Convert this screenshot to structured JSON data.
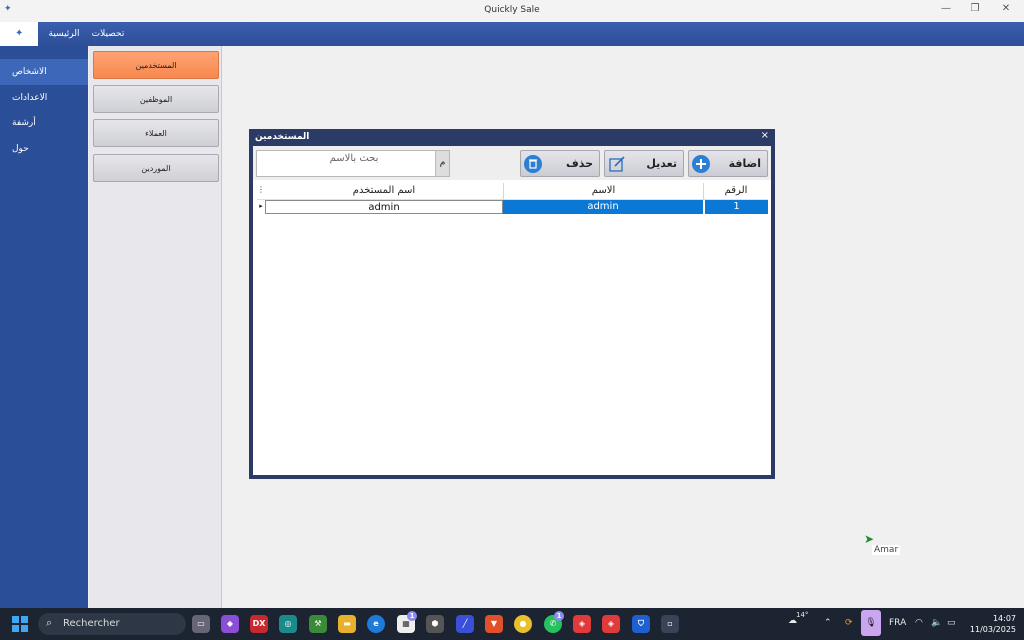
{
  "window": {
    "title": "Quickly Sale",
    "minimize_glyph": "—",
    "restore_glyph": "❐",
    "close_glyph": "✕"
  },
  "ribbon": {
    "tabs": [
      "الرئيسية",
      "تحصيلات"
    ]
  },
  "leftnav": {
    "items": [
      {
        "label": "الاشخاص",
        "active": true
      },
      {
        "label": "الاعدادات",
        "active": false
      },
      {
        "label": "أرشفة",
        "active": false
      },
      {
        "label": "حول",
        "active": false
      }
    ]
  },
  "subpanel": {
    "buttons": [
      {
        "label": "المستخدمين",
        "active": true
      },
      {
        "label": "الموظفين",
        "active": false
      },
      {
        "label": "العملاء",
        "active": false
      },
      {
        "label": "الموردين",
        "active": false
      }
    ]
  },
  "dialog": {
    "title": "المستخدمين",
    "close_glyph": "×",
    "search": {
      "placeholder": "بحث بالاسم",
      "button": "م"
    },
    "toolbar": {
      "add_label": "اضافة",
      "edit_label": "تعديل",
      "delete_label": "حذف"
    },
    "grid": {
      "columns": [
        "الرقم",
        "الاسم",
        "اسم المستخدم"
      ],
      "rows": [
        {
          "id": "1",
          "name": "admin",
          "username": "admin"
        }
      ]
    }
  },
  "cursor_label": "Amar",
  "taskbar": {
    "search_placeholder": "Rechercher",
    "weather": "14°",
    "language": "FRA",
    "time": "14:07",
    "date": "11/03/2025",
    "badges": {
      "store": "1",
      "whatsapp": "1"
    }
  },
  "colors": {
    "nav_bg": "#2b4e98",
    "accent_orange": "#f7884f",
    "selection_blue": "#0a78d4",
    "dialog_frame": "#2c3a66"
  }
}
